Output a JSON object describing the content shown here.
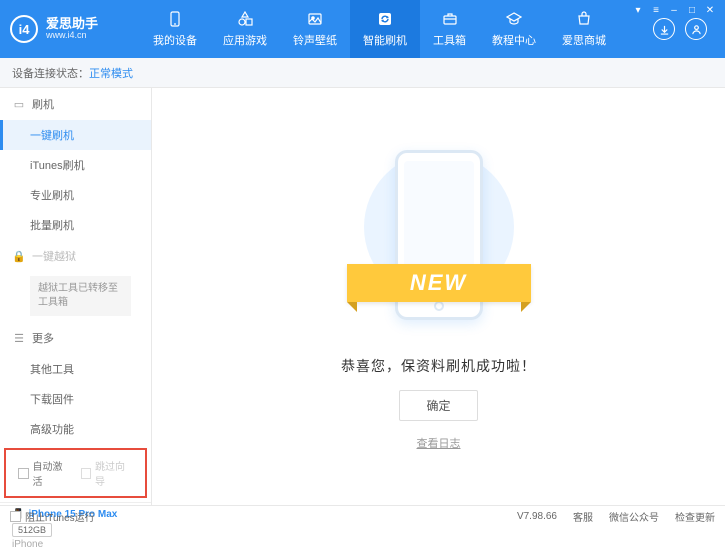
{
  "app": {
    "title": "爱思助手",
    "url": "www.i4.cn"
  },
  "nav": {
    "items": [
      {
        "label": "我的设备"
      },
      {
        "label": "应用游戏"
      },
      {
        "label": "铃声壁纸"
      },
      {
        "label": "智能刷机"
      },
      {
        "label": "工具箱"
      },
      {
        "label": "教程中心"
      },
      {
        "label": "爱思商城"
      }
    ]
  },
  "status": {
    "label": "设备连接状态：",
    "value": "正常模式"
  },
  "sidebar": {
    "flash_section": "刷机",
    "items": [
      {
        "label": "一键刷机"
      },
      {
        "label": "iTunes刷机"
      },
      {
        "label": "专业刷机"
      },
      {
        "label": "批量刷机"
      }
    ],
    "jailbreak": "一键越狱",
    "jailbreak_notice": "越狱工具已转移至工具箱",
    "more_section": "更多",
    "more_items": [
      {
        "label": "其他工具"
      },
      {
        "label": "下载固件"
      },
      {
        "label": "高级功能"
      }
    ],
    "auto_activate": "自动激活",
    "skip_guide": "跳过向导"
  },
  "device": {
    "name": "iPhone 15 Pro Max",
    "storage": "512GB",
    "type": "iPhone"
  },
  "main": {
    "ribbon": "NEW",
    "success": "恭喜您，保资料刷机成功啦！",
    "ok": "确定",
    "view_log": "查看日志"
  },
  "footer": {
    "block_itunes": "阻止iTunes运行",
    "version": "V7.98.66",
    "links": [
      "客服",
      "微信公众号",
      "检查更新"
    ]
  }
}
